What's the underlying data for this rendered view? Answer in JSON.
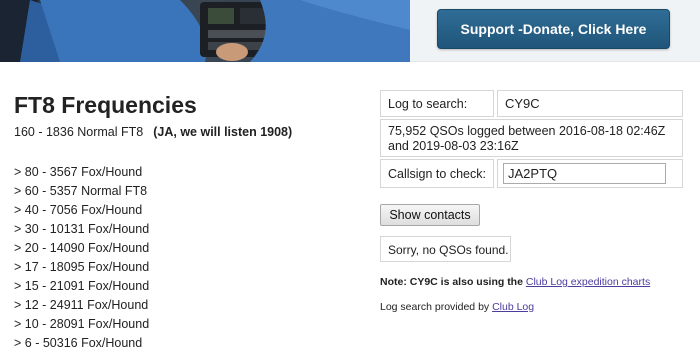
{
  "header": {
    "donate_label": "Support -Donate, Click Here"
  },
  "page": {
    "title": "FT8 Frequencies",
    "intro": "160 - 1836 Normal FT8",
    "intro_note": "(JA,  we will listen 1908)",
    "frequencies": [
      "> 80 - 3567 Fox/Hound",
      "> 60 - 5357 Normal FT8",
      "> 40 - 7056 Fox/Hound",
      "> 30 - 10131 Fox/Hound",
      "> 20 - 14090 Fox/Hound",
      "> 17 - 18095 Fox/Hound",
      "> 15 - 21091 Fox/Hound",
      "> 12 - 24911 Fox/Hound",
      "> 10 - 28091 Fox/Hound",
      "> 6 - 50316 Fox/Hound"
    ]
  },
  "logsearch": {
    "log_label": "Log to search:",
    "log_call": "CY9C",
    "qso_info": "75,952 QSOs logged between 2016-08-18 02:46Z and 2019-08-03 23:16Z",
    "callsign_label": "Callsign to check:",
    "callsign_value": "JA2PTQ",
    "show_button": "Show contacts",
    "result": "Sorry, no QSOs found.",
    "note_prefix": "Note: CY9C is also using the ",
    "note_link": "Club Log expedition charts",
    "provided_prefix": "Log search provided by ",
    "provided_link": "Club Log"
  }
}
